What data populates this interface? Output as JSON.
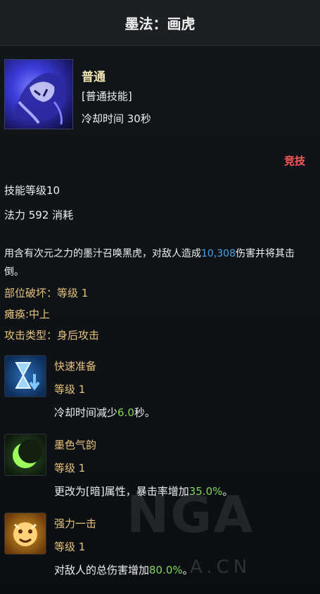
{
  "header": {
    "title": "墨法：画虎"
  },
  "skill": {
    "name": "普通",
    "type": "[普通技能]",
    "cooldown": "冷却时间 30秒",
    "mode": "竞技",
    "level": "技能等级10",
    "mana": "法力 592 消耗",
    "description_before": "用含有次元之力的墨汁召唤黑虎，对敌人造成",
    "description_damage": "10,308",
    "description_after": "伤害并将其击倒。",
    "part_break": "部位破坏：等级 1",
    "paralysis": "瘫痪:中上",
    "attack_type": "攻击类型：身后攻击"
  },
  "runes": [
    {
      "name": "快速准备",
      "level": "等级 1",
      "effect_before": "冷却时间减少",
      "effect_value": "6.0",
      "effect_after": "秒。",
      "icon": "hourglass-icon"
    },
    {
      "name": "墨色气韵",
      "level": "等级 1",
      "effect_before": "更改为[暗]属性，暴击率增加",
      "effect_value": "35.0%",
      "effect_after": "。",
      "icon": "crescent-moon-icon"
    },
    {
      "name": "强力一击",
      "level": "等级 1",
      "effect_before": "对敌人的总伤害增加",
      "effect_value": "80.0%",
      "effect_after": "。",
      "icon": "beast-face-icon"
    }
  ],
  "watermark": {
    "brand": "NGA",
    "url": "A.CN"
  },
  "colors": {
    "gold": "#e6c27a",
    "blue": "#4aa3e8",
    "green": "#7ed957",
    "red": "#ff5a5a"
  }
}
